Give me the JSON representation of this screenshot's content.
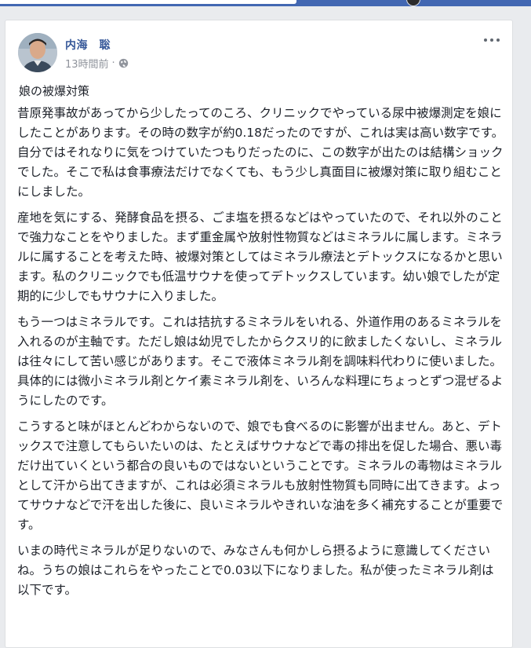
{
  "post": {
    "author": "内海　聡",
    "timestamp": "13時間前",
    "separator": "·",
    "privacy_icon": "globe-icon",
    "more_icon": "more-options-icon",
    "title": "娘の被爆対策",
    "paragraphs": [
      "昔原発事故があってから少したってのころ、クリニックでやっている尿中被爆測定を娘にしたことがあります。その時の数字が約0.18だったのですが、これは実は高い数字です。自分ではそれなりに気をつけていたつもりだったのに、この数字が出たのは結構ショックでした。そこで私は食事療法だけでなくても、もう少し真面目に被爆対策に取り組むことにしました。",
      "産地を気にする、発酵食品を摂る、ごま塩を摂るなどはやっていたので、それ以外のことで強力なことをやりました。まず重金属や放射性物質などはミネラルに属します。ミネラルに属することを考えた時、被爆対策としてはミネラル療法とデトックスになるかと思います。私のクリニックでも低温サウナを使ってデトックスしています。幼い娘でしたが定期的に少しでもサウナに入りました。",
      "もう一つはミネラルです。これは拮抗するミネラルをいれる、外道作用のあるミネラルを入れるのが主軸です。ただし娘は幼児でしたからクスリ的に飲ましたくないし、ミネラルは往々にして苦い感じがあります。そこで液体ミネラル剤を調味料代わりに使いました。具体的には微小ミネラル剤とケイ素ミネラル剤を、いろんな料理にちょっとずつ混ぜるようにしたのです。",
      "こうすると味がほとんどわからないので、娘でも食べるのに影響が出ません。あと、デトックスで注意してもらいたいのは、たとえばサウナなどで毒の排出を促した場合、悪い毒だけ出ていくという都合の良いものではないということです。ミネラルの毒物はミネラルとして汗から出てきますが、これは必須ミネラルも放射性物質も同時に出てきます。よってサウナなどで汗を出した後に、良いミネラルやきれいな油を多く補充することが重要です。",
      "いまの時代ミネラルが足りないので、みなさんも何かしら摂るように意識してくださいね。うちの娘はこれらをやったことで0.03以下になりました。私が使ったミネラル剤は以下です。"
    ]
  },
  "colors": {
    "topbar": "#4267b2",
    "author_link": "#365899",
    "meta_text": "#90949c",
    "body_text": "#1d2129",
    "page_bg": "#e9ebee"
  }
}
